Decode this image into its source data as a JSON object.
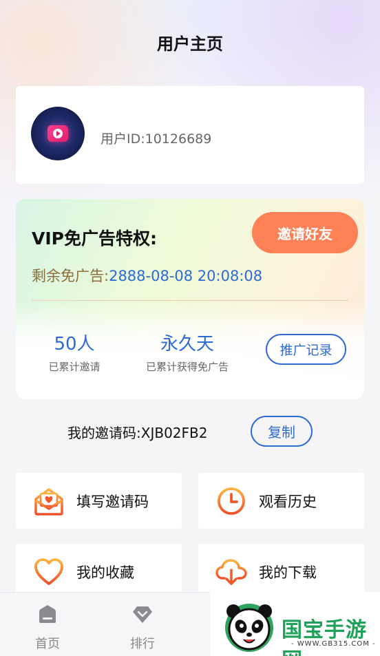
{
  "header": {
    "title": "用户主页"
  },
  "profile": {
    "user_id_text": "用户ID:10126689"
  },
  "vip": {
    "title": "VIP免广告特权:",
    "invite_button": "邀请好友",
    "remaining_label": "剩余免广告:",
    "remaining_date": "2888-08-08 20:08:08",
    "stats": [
      {
        "value": "50人",
        "label": "已累计邀请"
      },
      {
        "value": "永久天",
        "label": "已累计获得免广告"
      }
    ],
    "record_button": "推广记录"
  },
  "invite_code": {
    "label": "我的邀请码:",
    "code": "XJB02FB2",
    "copy_button": "复制"
  },
  "menu": [
    {
      "label": "填写邀请码",
      "icon": "envelope-heart-icon"
    },
    {
      "label": "观看历史",
      "icon": "clock-icon"
    },
    {
      "label": "我的收藏",
      "icon": "heart-icon"
    },
    {
      "label": "我的下载",
      "icon": "cloud-download-icon"
    }
  ],
  "tabbar": [
    {
      "label": "首页",
      "icon": "home-icon"
    },
    {
      "label": "排行",
      "icon": "diamond-icon"
    }
  ],
  "watermark": {
    "brand": "国宝手游网",
    "url": "- WWW.GB315.COM -"
  },
  "colors": {
    "accent_blue": "#2d6ad5",
    "invite_orange": "#fe8056",
    "remaining_brown": "#8a6e3c",
    "icon_orange": "#f05a28"
  }
}
